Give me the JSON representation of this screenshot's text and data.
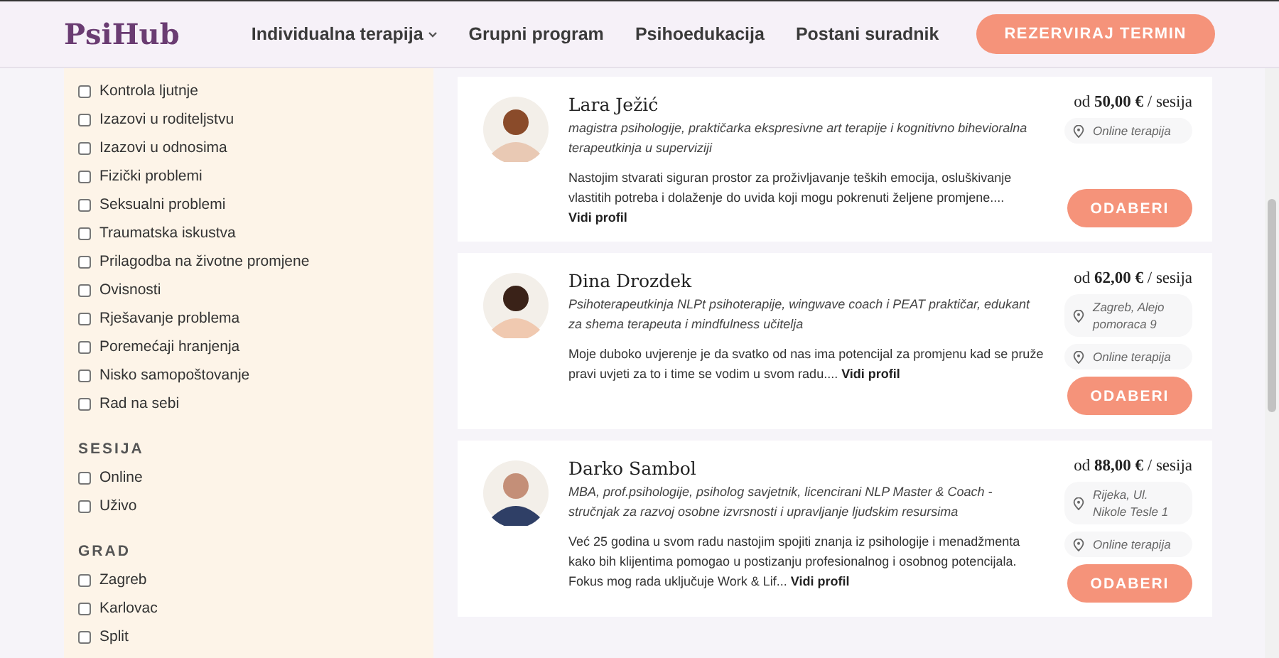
{
  "header": {
    "logo": "PsiHub",
    "nav": [
      {
        "label": "Individualna terapija",
        "dropdown": true
      },
      {
        "label": "Grupni program",
        "dropdown": false
      },
      {
        "label": "Psihoedukacija",
        "dropdown": false
      },
      {
        "label": "Postani suradnik",
        "dropdown": false
      }
    ],
    "cta": "REZERVIRAJ TERMIN"
  },
  "filters": [
    {
      "items": [
        {
          "label": "Kontrola ljutnje",
          "checked": false
        },
        {
          "label": "Izazovi u roditeljstvu",
          "checked": false
        },
        {
          "label": "Izazovi u odnosima",
          "checked": false
        },
        {
          "label": "Fizički problemi",
          "checked": false
        },
        {
          "label": "Seksualni problemi",
          "checked": false
        },
        {
          "label": "Traumatska iskustva",
          "checked": false
        },
        {
          "label": "Prilagodba na životne promjene",
          "checked": false
        },
        {
          "label": "Ovisnosti",
          "checked": false
        },
        {
          "label": "Rješavanje problema",
          "checked": false
        },
        {
          "label": "Poremećaji hranjenja",
          "checked": false
        },
        {
          "label": "Nisko samopoštovanje",
          "checked": false
        },
        {
          "label": "Rad na sebi",
          "checked": false
        }
      ]
    },
    {
      "title": "SESIJA",
      "items": [
        {
          "label": "Online",
          "checked": false
        },
        {
          "label": "Uživo",
          "checked": false
        }
      ]
    },
    {
      "title": "GRAD",
      "items": [
        {
          "label": "Zagreb",
          "checked": false
        },
        {
          "label": "Karlovac",
          "checked": false
        },
        {
          "label": "Split",
          "checked": false
        }
      ]
    }
  ],
  "therapists": [
    {
      "name": "Lara Ježić",
      "title": "magistra psihologije, praktičarka ekspresivne art terapije i kognitivno bihevioralna terapeutkinja u superviziji",
      "bio": "Nastojim stvarati siguran prostor za proživljavanje teških emocija, osluškivanje vlastitih potreba i dolaženje do uvida koji mogu pokrenuti željene promjene....",
      "link": "Vidi profil",
      "price": "od **50,00 €** / sesija",
      "locations": [
        "Online terapija"
      ],
      "button": "ODABERI"
    },
    {
      "name": "Dina Drozdek",
      "title": "Psihoterapeutkinja NLPt psihoterapije, wingwave coach i PEAT praktičar, edukant za shema terapeuta i mindfulness učitelja",
      "bio": "Moje duboko uvjerenje je da svatko od nas ima potencijal za promjenu kad se pruže pravi uvjeti za to i time se vodim u svom radu....",
      "link": "Vidi profil",
      "price": "od **62,00 €** / sesija",
      "locations": [
        "Zagreb, Alejo pomoraca 9",
        "Online terapija"
      ],
      "button": "ODABERI"
    },
    {
      "name": "Darko Sambol",
      "title": "MBA, prof.psihologije, psiholog savjetnik, licencirani NLP Master & Coach - stručnjak za razvoj osobne izvrsnosti i upravljanje ljudskim resursima",
      "bio": "Već 25 godina u svom radu nastojim spojiti znanja iz psihologije i menadžmenta kako bih klijentima pomogao u postizanju profesionalnog i osobnog potencijala. Fokus mog rada uključuje Work & Lif...",
      "link": "Vidi profil",
      "price": "od **88,00 €** / sesija",
      "locations": [
        "Rijeka, Ul. Nikole Tesle 1",
        "Online terapija"
      ],
      "button": "ODABERI"
    }
  ]
}
